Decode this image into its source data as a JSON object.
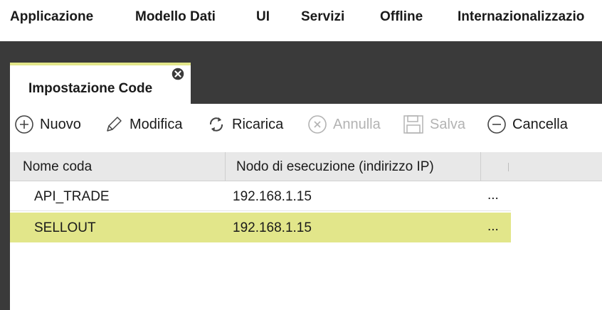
{
  "menu": {
    "items": [
      {
        "label": "Applicazione"
      },
      {
        "label": "Modello Dati"
      },
      {
        "label": "UI"
      },
      {
        "label": "Servizi"
      },
      {
        "label": "Offline"
      },
      {
        "label": "Internazionalizzazio"
      }
    ]
  },
  "tab": {
    "label": "Impostazione Code",
    "close_icon": "close-icon"
  },
  "toolbar": {
    "new_label": "Nuovo",
    "edit_label": "Modifica",
    "reload_label": "Ricarica",
    "undo_label": "Annulla",
    "save_label": "Salva",
    "delete_label": "Cancella",
    "icons": [
      "plus-circle-icon",
      "pencil-icon",
      "refresh-icon",
      "x-circle-icon",
      "floppy-disk-icon",
      "minus-circle-icon"
    ]
  },
  "grid": {
    "columns": [
      "Nome coda",
      "Nodo di esecuzione (indirizzo IP)"
    ],
    "rows": [
      {
        "name": "API_TRADE",
        "ip": "192.168.1.15",
        "more": "...",
        "selected": false
      },
      {
        "name": "SELLOUT",
        "ip": "192.168.1.15",
        "more": "...",
        "selected": true
      }
    ]
  },
  "colors": {
    "accent": "#e2e68a",
    "dark_band": "#3a3a3a",
    "header_bg": "#e8e8e8",
    "disabled_text": "#b3b3b3"
  }
}
